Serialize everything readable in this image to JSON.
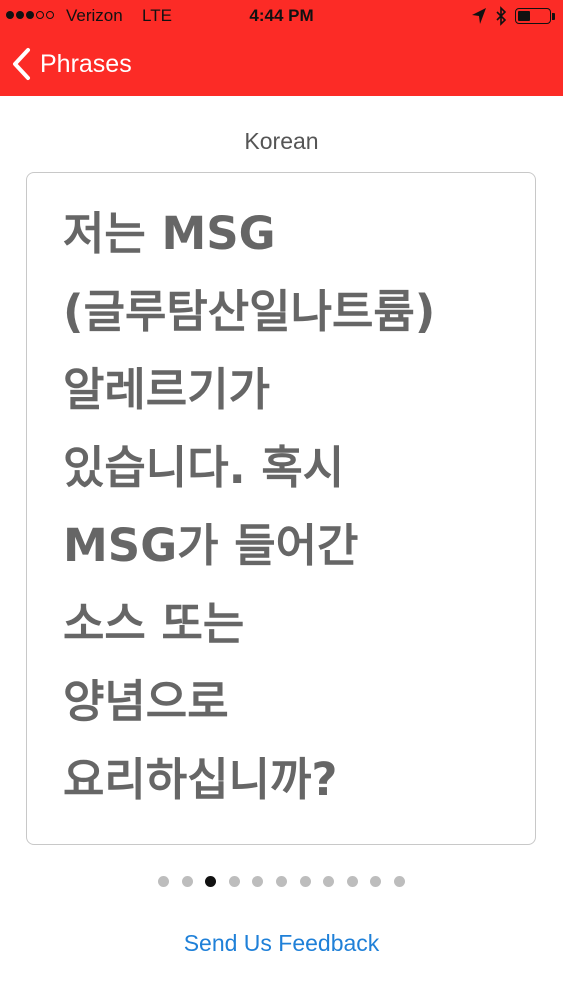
{
  "status_bar": {
    "carrier": "Verizon",
    "network": "LTE",
    "time": "4:44 PM",
    "signal_bars_filled": 3,
    "signal_bars_total": 5,
    "battery_level": 0.4
  },
  "nav": {
    "back_label": "Phrases",
    "back_icon": "chevron-left-icon",
    "bar_color": "#fc2b26"
  },
  "phrase": {
    "language": "Korean",
    "lines": [
      "저는 MSG",
      "(글루탐산일나트륨)",
      "알레르기가",
      "있습니다. 혹시",
      "MSG가 들어간",
      "소스 또는",
      "양념으로",
      "요리하십니까?"
    ]
  },
  "pagination": {
    "total": 11,
    "current": 3
  },
  "footer": {
    "feedback_label": "Send Us Feedback",
    "link_color": "#1f80d8"
  }
}
